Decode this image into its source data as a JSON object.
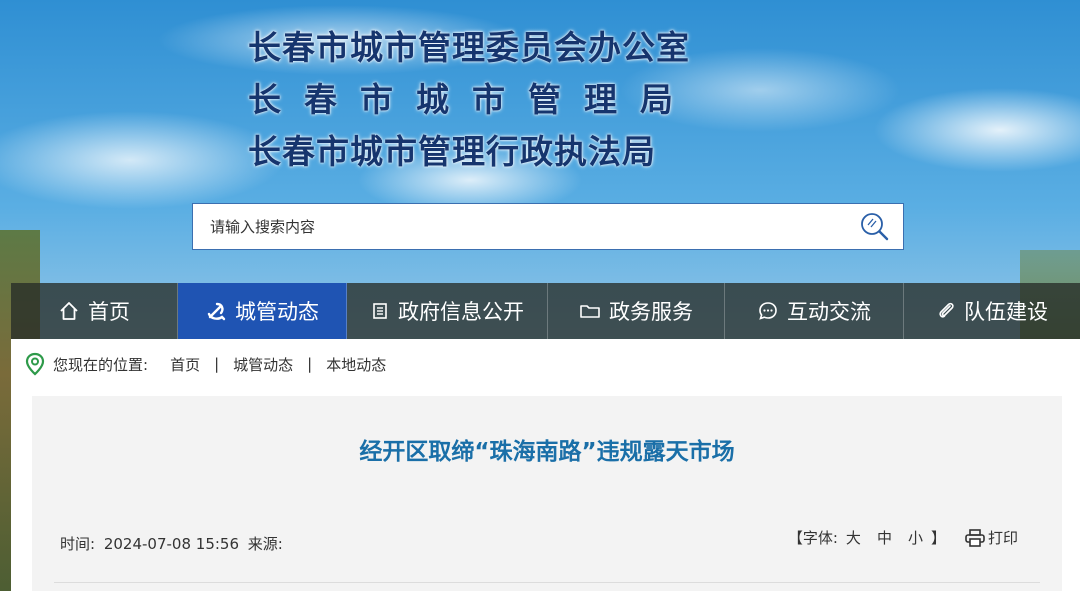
{
  "header": {
    "titles": [
      "长春市城市管理委员会办公室",
      "长春市城市管理局",
      "长春市城市管理行政执法局"
    ]
  },
  "search": {
    "placeholder": "请输入搜索内容"
  },
  "nav": {
    "items": [
      {
        "label": "首页",
        "icon": "home-icon"
      },
      {
        "label": "城管动态",
        "icon": "party-emblem-icon",
        "active": true
      },
      {
        "label": "政府信息公开",
        "icon": "document-icon"
      },
      {
        "label": "政务服务",
        "icon": "folder-icon"
      },
      {
        "label": "互动交流",
        "icon": "chat-icon"
      },
      {
        "label": "队伍建设",
        "icon": "paperclip-icon"
      }
    ]
  },
  "breadcrumb": {
    "label": "您现在的位置:",
    "items": [
      "首页",
      "城管动态",
      "本地动态"
    ],
    "separator": "|"
  },
  "article": {
    "title": "经开区取缔“珠海南路”违规露天市场",
    "time_label": "时间:",
    "time_value": "2024-07-08 15:56",
    "source_label": "来源:",
    "font_label": "【字体:",
    "font_sizes": [
      "大",
      "中",
      "小"
    ],
    "font_close": "】",
    "print_label": "打印"
  },
  "colors": {
    "nav_active": "#1f54b3",
    "title_blue": "#16356e",
    "article_title": "#1a6fa8",
    "location_icon": "#2e9a4a"
  }
}
